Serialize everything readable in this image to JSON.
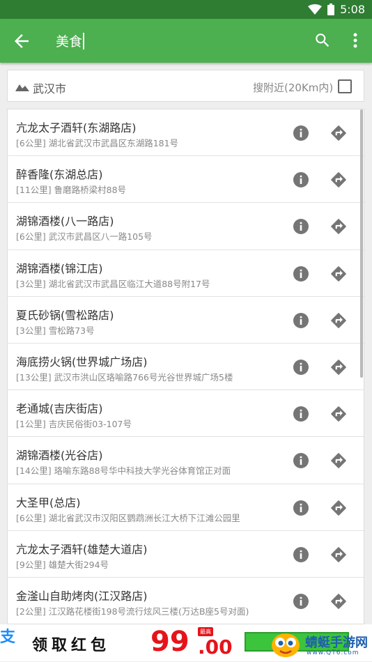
{
  "status_bar": {
    "time": "5:08"
  },
  "app_bar": {
    "query": "美食"
  },
  "filter": {
    "city": "武汉市",
    "nearby_label": "搜附近(20Km内)",
    "nearby_checked": false
  },
  "results": [
    {
      "name": "亢龙太子酒轩(东湖路店)",
      "distance": "[6公里]",
      "address": "湖北省武汉市武昌区东湖路181号"
    },
    {
      "name": "醉香隆(东湖总店)",
      "distance": "[11公里]",
      "address": "鲁磨路桥梁村88号"
    },
    {
      "name": "湖锦酒楼(八一路店)",
      "distance": "[6公里]",
      "address": "武汉市武昌区八一路105号"
    },
    {
      "name": "湖锦酒楼(锦江店)",
      "distance": "[3公里]",
      "address": "湖北省武汉市武昌区临江大道88号附17号"
    },
    {
      "name": "夏氏砂锅(雪松路店)",
      "distance": "[3公里]",
      "address": "雪松路73号"
    },
    {
      "name": "海底捞火锅(世界城广场店)",
      "distance": "[13公里]",
      "address": "武汉市洪山区珞喻路766号光谷世界城广场5楼"
    },
    {
      "name": "老通城(吉庆街店)",
      "distance": "[1公里]",
      "address": "吉庆民俗街03-107号"
    },
    {
      "name": "湖锦酒楼(光谷店)",
      "distance": "[14公里]",
      "address": "珞喻东路88号华中科技大学光谷体育馆正对面"
    },
    {
      "name": "大圣甲(总店)",
      "distance": "[6公里]",
      "address": "湖北省武汉市汉阳区鹦鹉洲长江大桥下江滩公园里"
    },
    {
      "name": "亢龙太子酒轩(雄楚大道店)",
      "distance": "[9公里]",
      "address": "雄楚大街294号"
    },
    {
      "name": "金滏山自助烤肉(江汉路店)",
      "distance": "[2公里]",
      "address": "江汉路花楼街198号流行炫风三楼(万达B座5号对面)"
    }
  ],
  "ad": {
    "alipay": "支",
    "title": "领取红包",
    "price_int": "99",
    "price_dec": ".00",
    "tag": "最高",
    "site_name": "蜻蜓手游网",
    "site_url": "www.QT6.com"
  },
  "colors": {
    "app_bar": "#4caf50",
    "status_bar": "#2e7d32",
    "icon_gray": "#757575"
  },
  "icons": [
    "back-arrow-icon",
    "search-icon",
    "more-vert-icon",
    "mountain-icon",
    "info-icon",
    "directions-icon"
  ]
}
